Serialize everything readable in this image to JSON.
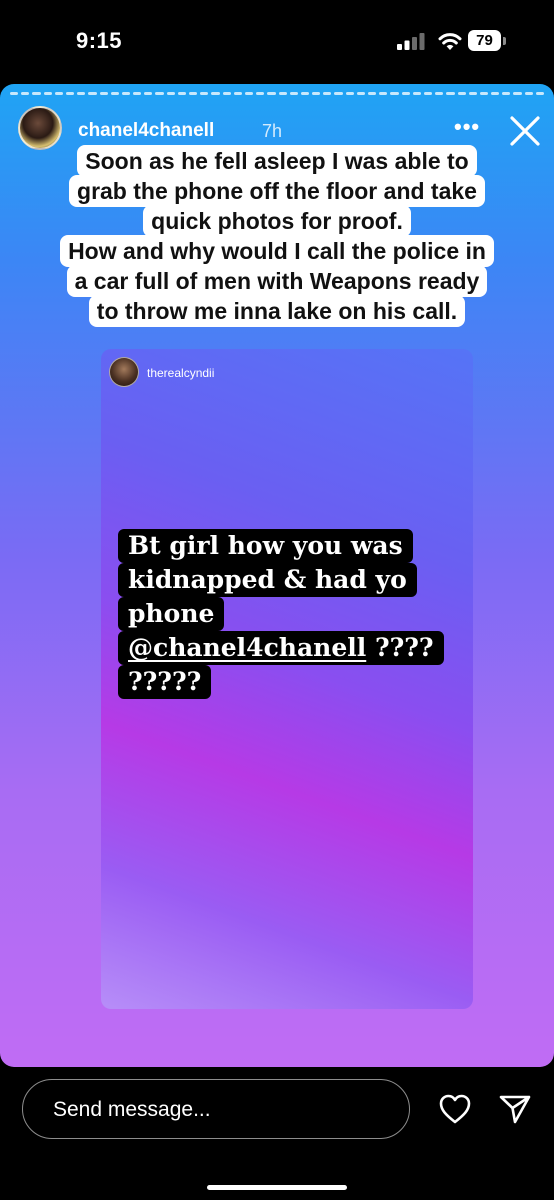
{
  "status_bar": {
    "time": "9:15",
    "battery": "79"
  },
  "story": {
    "username": "chanel4chanell",
    "age": "7h",
    "more_label": "•••",
    "caption_lines": [
      "Soon as he fell asleep I was able to",
      "grab the phone off the floor and  take",
      "quick photos for proof.",
      "How and why would I call the police in",
      "a car full of men with Weapons ready",
      "to throw me inna lake on his call."
    ],
    "shared_post": {
      "username": "therealcyndii",
      "quote_lines": [
        "Bt girl how you was",
        "kidnapped & had yo",
        "phone",
        "@chanel4chanell  ????",
        "?????"
      ]
    }
  },
  "reply": {
    "placeholder": "Send message..."
  }
}
